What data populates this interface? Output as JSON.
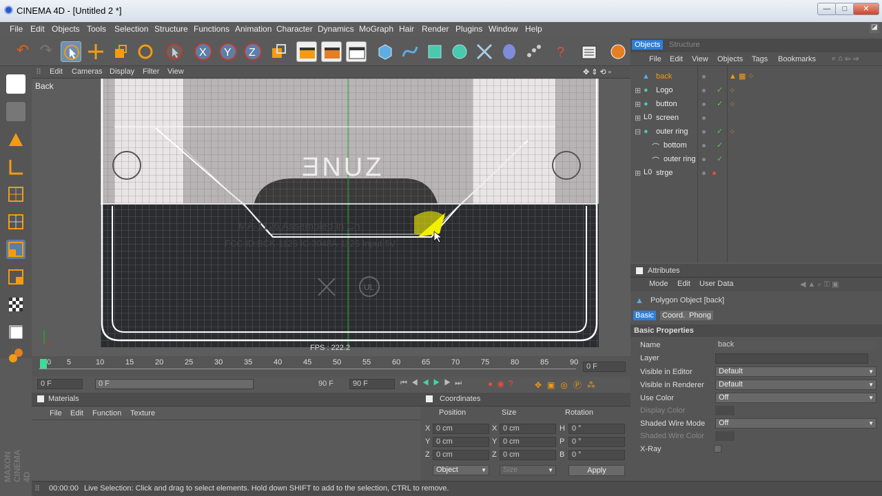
{
  "window": {
    "title": "CINEMA 4D - [Untitled 2 *]",
    "minimize": "—",
    "maximize": "□",
    "close": "✕"
  },
  "menu": [
    "File",
    "Edit",
    "Objects",
    "Tools",
    "Selection",
    "Structure",
    "Functions",
    "Animation",
    "Character",
    "Dynamics",
    "MoGraph",
    "Hair",
    "Render",
    "Plugins",
    "Window",
    "Help"
  ],
  "viewport": {
    "menu": [
      "Edit",
      "Cameras",
      "Display",
      "Filter",
      "View"
    ],
    "label": "Back",
    "fps": "FPS : 222.2",
    "overlay_logo": "ƎNUZ",
    "overlay_text1": "MA-1126 Assembled in Ch",
    "overlay_text2": "FCC ID:BCK-1126 IC:3048A-1126 Input 5V",
    "overlay_ul": "UL",
    "colors": {
      "accent_yellow": "#f2f000",
      "grid": "#7c7c7c",
      "axis_green": "#22aa22"
    }
  },
  "timeline": {
    "ticks": [
      "0",
      "5",
      "10",
      "15",
      "20",
      "25",
      "30",
      "35",
      "40",
      "45",
      "50",
      "55",
      "60",
      "65",
      "70",
      "75",
      "80",
      "85",
      "90"
    ],
    "current_frame": "0 F"
  },
  "anim": {
    "start": "0 F",
    "range_start": "0 F",
    "range_end": "90 F",
    "end": "90 F"
  },
  "objects_panel": {
    "tabs": [
      "Objects",
      "Structure"
    ],
    "menu": [
      "File",
      "Edit",
      "View",
      "Objects",
      "Tags",
      "Bookmarks"
    ],
    "items": [
      {
        "label": "back",
        "selected": true
      },
      {
        "label": "Logo"
      },
      {
        "label": "button"
      },
      {
        "label": "screen"
      },
      {
        "label": "outer ring"
      },
      {
        "label": "bottom"
      },
      {
        "label": "outer ring"
      },
      {
        "label": "strge"
      }
    ]
  },
  "attributes": {
    "title": "Attributes",
    "menu": [
      "Mode",
      "Edit",
      "User Data"
    ],
    "object": "Polygon Object [back]",
    "tabs": [
      "Basic",
      "Coord.",
      "Phong"
    ],
    "section": "Basic Properties",
    "fields": [
      {
        "label": "Name",
        "value": "back"
      },
      {
        "label": "Layer",
        "value": ""
      },
      {
        "label": "Visible in Editor",
        "value": "Default"
      },
      {
        "label": "Visible in Renderer",
        "value": "Default"
      },
      {
        "label": "Use Color",
        "value": "Off"
      },
      {
        "label": "Display Color",
        "value": ""
      },
      {
        "label": "Shaded Wire Mode",
        "value": "Off"
      },
      {
        "label": "Shaded Wire Color",
        "value": ""
      },
      {
        "label": "X-Ray",
        "value": ""
      }
    ]
  },
  "materials": {
    "title": "Materials",
    "menu": [
      "File",
      "Edit",
      "Function",
      "Texture"
    ]
  },
  "coordinates": {
    "title": "Coordinates",
    "headers": [
      "Position",
      "Size",
      "Rotation"
    ],
    "rows": [
      {
        "axis": "X",
        "pos": "0 cm",
        "saxis": "X",
        "size": "0 cm",
        "raxis": "H",
        "rot": "0 °"
      },
      {
        "axis": "Y",
        "pos": "0 cm",
        "saxis": "Y",
        "size": "0 cm",
        "raxis": "P",
        "rot": "0 °"
      },
      {
        "axis": "Z",
        "pos": "0 cm",
        "saxis": "Z",
        "size": "0 cm",
        "raxis": "B",
        "rot": "0 °"
      }
    ],
    "mode": "Object",
    "size_mode": "Size",
    "apply": "Apply"
  },
  "status": {
    "time": "00:00:00",
    "message": "Live Selection: Click and drag to select elements. Hold down SHIFT to add to the selection, CTRL to remove."
  },
  "brand": "MAXON CINEMA 4D"
}
